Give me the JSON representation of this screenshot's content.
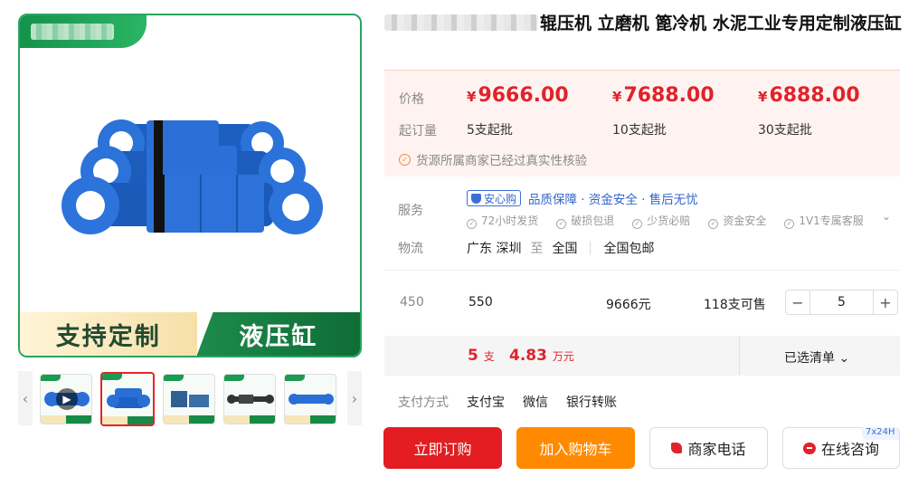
{
  "product": {
    "title": "辊压机 立磨机 篦冷机 水泥工业专用定制液压缸",
    "banner_left": "支持定制",
    "banner_right": "液压缸"
  },
  "gallery": {
    "prev_icon": "‹",
    "next_icon": "›",
    "thumb_count": 5,
    "active_thumb": 2
  },
  "prices": {
    "label": "价格",
    "moq_label": "起订量",
    "currency": "¥",
    "tiers": [
      {
        "price": "9666.00",
        "moq": "5支起批"
      },
      {
        "price": "7688.00",
        "moq": "10支起批"
      },
      {
        "price": "6888.00",
        "moq": "30支起批"
      }
    ],
    "verify_text": "货源所属商家已经过真实性核验"
  },
  "service": {
    "label": "服务",
    "badge": "安心购",
    "headline": "品质保障 · 资金安全 · 售后无忧",
    "items": [
      "72小时发货",
      "破损包退",
      "少货必赔",
      "资金安全",
      "1V1专属客服"
    ]
  },
  "logistics": {
    "label": "物流",
    "from": "广东 深圳",
    "to_word": "至",
    "to": "全国",
    "shipping": "全国包邮"
  },
  "sku": {
    "spec": "450",
    "size": "550",
    "price": "9666元",
    "stock": "118支可售",
    "quantity": "5",
    "minus": "−",
    "plus": "+"
  },
  "summary": {
    "qty": "5",
    "qty_unit": "支",
    "amount": "4.83",
    "amount_unit": "万元",
    "selected": "已选清单 ⌄"
  },
  "payment": {
    "label": "支付方式",
    "methods": [
      "支付宝",
      "微信",
      "银行转账"
    ]
  },
  "actions": {
    "buy": "立即订购",
    "cart": "加入购物车",
    "phone": "商家电话",
    "chat": "在线咨询",
    "chat_badge": "7x24H"
  },
  "colors": {
    "price_red": "#e0232b",
    "brand_green": "#2aa560",
    "cart_orange": "#ff8a00",
    "link_blue": "#3366cc"
  }
}
